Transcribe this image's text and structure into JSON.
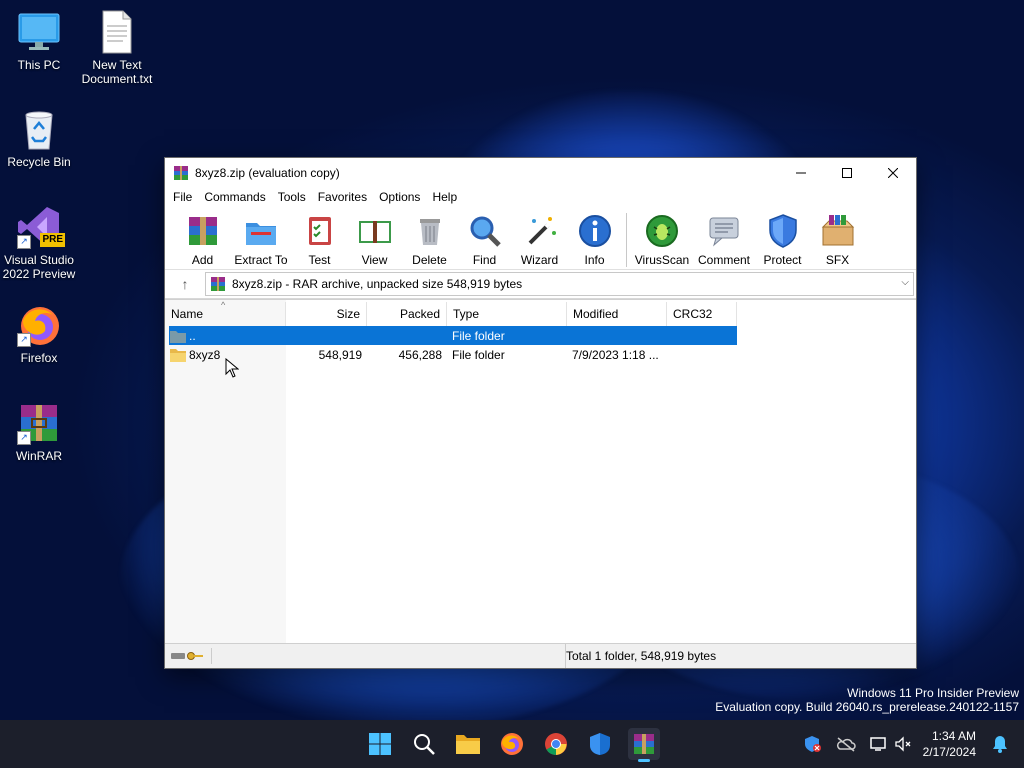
{
  "desktop": {
    "icons": [
      {
        "label": "This PC"
      },
      {
        "label": "New Text Document.txt"
      },
      {
        "label": "Recycle Bin"
      },
      {
        "label": "Visual Studio 2022 Preview",
        "badge": "PRE"
      },
      {
        "label": "Firefox"
      },
      {
        "label": "WinRAR"
      }
    ]
  },
  "window": {
    "title": "8xyz8.zip (evaluation copy)",
    "menu": [
      "File",
      "Commands",
      "Tools",
      "Favorites",
      "Options",
      "Help"
    ],
    "toolbar": [
      "Add",
      "Extract To",
      "Test",
      "View",
      "Delete",
      "Find",
      "Wizard",
      "Info",
      "VirusScan",
      "Comment",
      "Protect",
      "SFX"
    ],
    "address": "8xyz8.zip - RAR archive, unpacked size 548,919 bytes",
    "columns": {
      "name": "Name",
      "size": "Size",
      "packed": "Packed",
      "type": "Type",
      "modified": "Modified",
      "crc": "CRC32"
    },
    "rows": [
      {
        "name": "..",
        "size": "",
        "packed": "",
        "type": "File folder",
        "modified": "",
        "crc": ""
      },
      {
        "name": "8xyz8",
        "size": "548,919",
        "packed": "456,288",
        "type": "File folder",
        "modified": "7/9/2023 1:18 ...",
        "crc": ""
      }
    ],
    "status": "Total 1 folder, 548,919 bytes"
  },
  "watermark": {
    "line1": "Windows 11 Pro Insider Preview",
    "line2": "Evaluation copy. Build 26040.rs_prerelease.240122-1157"
  },
  "taskbar": {
    "time": "1:34 AM",
    "date": "2/17/2024"
  },
  "colors": {
    "selection": "#0a74d6",
    "taskbar": "#1c1f2b"
  }
}
